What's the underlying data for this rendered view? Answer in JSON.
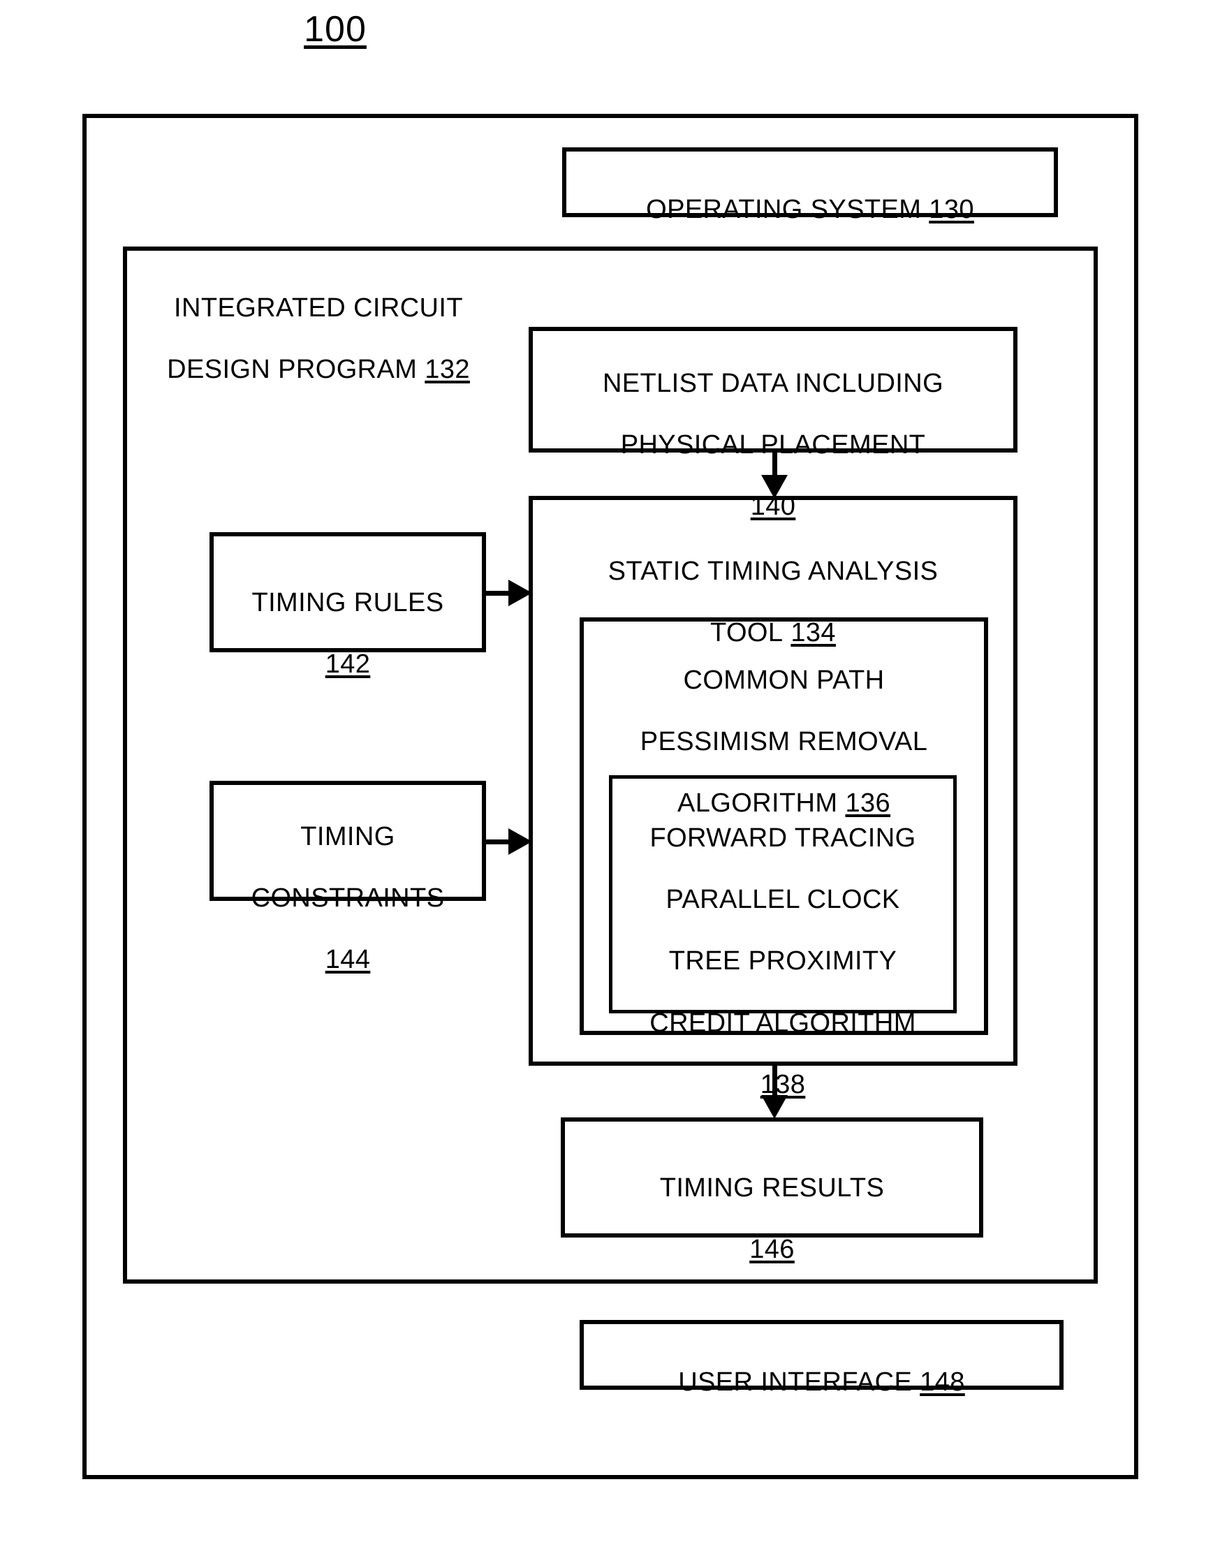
{
  "figure": {
    "number": "100"
  },
  "outer_frame": {
    "name": "system-frame"
  },
  "boxes": {
    "operating_system": {
      "title": "OPERATING SYSTEM",
      "ref": "130"
    },
    "ic_design_program": {
      "line1": "INTEGRATED CIRCUIT",
      "line2": "DESIGN PROGRAM",
      "ref": "132"
    },
    "netlist_data": {
      "line1": "NETLIST DATA INCLUDING",
      "line2": "PHYSICAL PLACEMENT",
      "ref": "140"
    },
    "timing_rules": {
      "line1": "TIMING RULES",
      "ref": "142"
    },
    "timing_constraints": {
      "line1": "TIMING",
      "line2": "CONSTRAINTS",
      "ref": "144"
    },
    "static_timing_analysis_tool": {
      "line1": "STATIC TIMING ANALYSIS",
      "line2": "TOOL",
      "ref": "134"
    },
    "cppr_algorithm": {
      "line1": "COMMON PATH",
      "line2": "PESSIMISM REMOVAL",
      "line3": "ALGORITHM",
      "ref": "136"
    },
    "forward_tracing_algorithm": {
      "line1": "FORWARD TRACING",
      "line2": "PARALLEL  CLOCK",
      "line3": "TREE  PROXIMITY",
      "line4": "CREDIT ALGORITHM",
      "ref": "138"
    },
    "timing_results": {
      "line1": "TIMING RESULTS",
      "ref": "146"
    },
    "user_interface": {
      "title": "USER INTERFACE",
      "ref": "148"
    }
  },
  "connectors": {
    "netlist_to_sta": "arrow-down",
    "timing_rules_to_sta": "arrow-right",
    "timing_constraints_to_sta": "arrow-right",
    "sta_to_timing_results": "arrow-down"
  },
  "colors": {
    "stroke": "#000000",
    "background": "#ffffff"
  }
}
